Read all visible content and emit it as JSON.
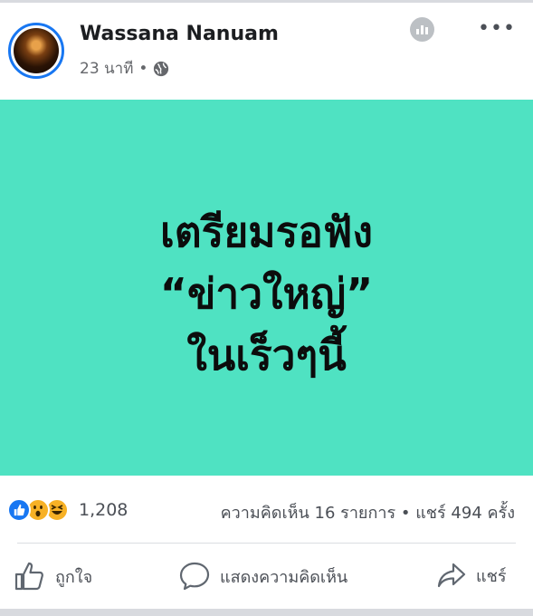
{
  "post": {
    "author": "Wassana Nanuam",
    "time": "23 นาที",
    "separator": "•",
    "image_text": {
      "line1": "เตรียมรอฟัง",
      "line2": "“ข่าวใหญ่”",
      "line3": "ในเร็วๆนี้"
    }
  },
  "reactions": {
    "count": "1,208",
    "summary": "ความคิดเห็น 16 รายการ • แชร์ 494 ครั้ง"
  },
  "actions": {
    "like": "ถูกใจ",
    "comment": "แสดงความคิดเห็น",
    "share": "แชร์"
  },
  "colors": {
    "post_background": "#4fe2c2",
    "accent": "#1877f2"
  },
  "icons": [
    "globe-icon",
    "stats-icon",
    "more-icon",
    "like-reaction-icon",
    "wow-reaction-icon",
    "haha-reaction-icon",
    "like-icon",
    "comment-icon",
    "share-icon"
  ]
}
